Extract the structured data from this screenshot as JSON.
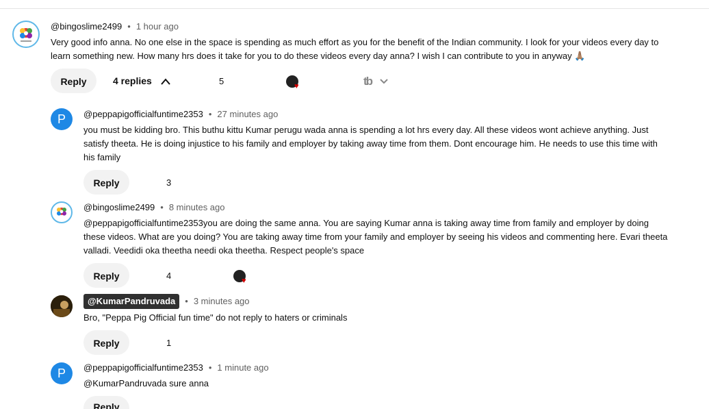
{
  "comments": [
    {
      "handle": "@bingoslime2499",
      "time": "1 hour ago",
      "text": "Very good info anna. No one else in the space is spending as much effort as you for the benefit of the Indian community. I look for your videos every day to learn something new. How many hrs does it take for you to do these videos every day anna? I wish I can contribute to you in anyway 🙏🏽",
      "reply_label": "Reply",
      "replies_label": "4 replies",
      "likes": "5",
      "creator_icon": "tb"
    },
    {
      "handle": "@peppapigofficialfuntime2353",
      "time": "27 minutes ago",
      "avatar_letter": "P",
      "text": "you must be kidding bro. This buthu kittu Kumar perugu wada anna is spending a lot hrs every day. All these videos wont achieve anything. Just satisfy theeta. He is doing injustice to his family and employer by taking away time from them. Dont encourage him. He needs to use this time with his family",
      "reply_label": "Reply",
      "likes": "3"
    },
    {
      "handle": "@bingoslime2499",
      "time": "8 minutes ago",
      "text": "@peppapigofficialfuntime2353you are doing the same anna. You are saying Kumar anna is taking away time from family and employer by doing these videos. What are you doing? You are taking away time from your family and employer by seeing his videos and commenting here. Evari theeta valladi. Veedidi oka theetha needi oka theetha. Respect people's space",
      "reply_label": "Reply",
      "likes": "4"
    },
    {
      "handle": "@KumarPandruvada",
      "time": "3 minutes ago",
      "text": "Bro, \"Peppa Pig Official fun time\" do not reply to haters or criminals",
      "reply_label": "Reply",
      "likes": "1"
    },
    {
      "handle": "@peppapigofficialfuntime2353",
      "time": "1 minute ago",
      "avatar_letter": "P",
      "text": "@KumarPandruvada sure anna",
      "reply_label": "Reply"
    }
  ],
  "colors": {
    "avatar_p": "#1e88e5",
    "heart": "#d00000",
    "owner_chip": "#303030"
  }
}
